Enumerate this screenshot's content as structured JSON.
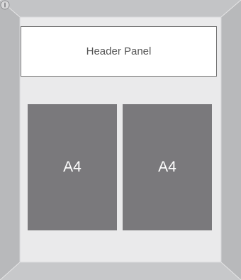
{
  "header_panel": {
    "label": "Header Panel"
  },
  "sheets": [
    {
      "label": "A4"
    },
    {
      "label": "A4"
    }
  ],
  "colors": {
    "frame_outer": "#a9aaad",
    "frame_inner": "#cdced0",
    "board": "#eaeaeb",
    "sheet": "#7a797c",
    "header_border": "#6f6f6f"
  },
  "icons": {
    "lock": "lock-icon"
  }
}
